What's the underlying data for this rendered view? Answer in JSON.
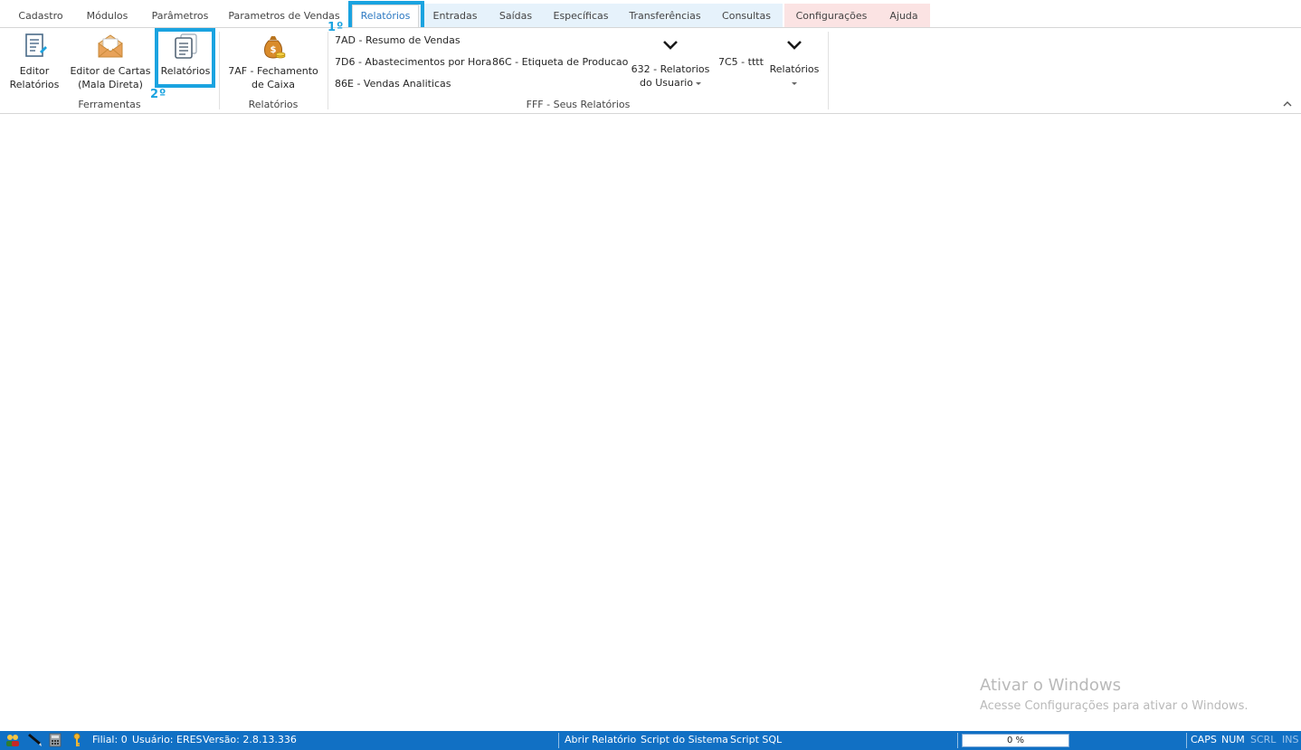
{
  "tabs": [
    {
      "label": "Cadastro"
    },
    {
      "label": "Módulos"
    },
    {
      "label": "Parâmetros"
    },
    {
      "label": "Parametros de Vendas"
    },
    {
      "label": "Relatórios"
    },
    {
      "label": "Entradas"
    },
    {
      "label": "Saídas"
    },
    {
      "label": "Específicas"
    },
    {
      "label": "Transferências"
    },
    {
      "label": "Consultas"
    },
    {
      "label": "Configurações"
    },
    {
      "label": "Ajuda"
    }
  ],
  "annotations": {
    "step1": "1º",
    "step2": "2º"
  },
  "ribbon": {
    "ferramentas": {
      "editor_relatorios_l1": "Editor",
      "editor_relatorios_l2": "Relatórios",
      "editor_cartas_l1": "Editor de Cartas",
      "editor_cartas_l2": "(Mala Direta)",
      "relatorios": "Relatórios",
      "group_label": "Ferramentas"
    },
    "relatorios_group": {
      "fechamento_l1": "7AF - Fechamento",
      "fechamento_l2": "de Caixa",
      "group_label": "Relatórios"
    },
    "seus_relatorios": {
      "resumo_vendas": "7AD - Resumo de Vendas",
      "abastecimentos": "7D6 - Abastecimentos por Hora",
      "vendas_analiticas": "86E - Vendas Analiticas",
      "etiqueta_producao": "86C - Etiqueta de Producao",
      "relatorios_usuario_l1": "632 - Relatorios",
      "relatorios_usuario_l2": "do Usuario",
      "tttt": "7C5 - tttt",
      "relatorios_menu": "Relatórios",
      "group_label": "FFF - Seus Relatórios"
    }
  },
  "watermark": {
    "title": "Ativar o Windows",
    "subtitle": "Acesse Configurações para ativar o Windows."
  },
  "statusbar": {
    "filial": "Filial: 0",
    "usuario": "Usuário: ERES",
    "versao": "Versão: 2.8.13.336",
    "abrir_relatorio": "Abrir Relatório",
    "script_sistema": "Script do Sistema",
    "script_sql": "Script SQL",
    "progress": "0 %",
    "caps": "CAPS",
    "num": "NUM",
    "scrl": "SCRL",
    "ins": "INS"
  },
  "colors": {
    "accent": "#1aa3e0",
    "statusbar": "#1170c4",
    "tab_active_text": "#2b78c2"
  }
}
